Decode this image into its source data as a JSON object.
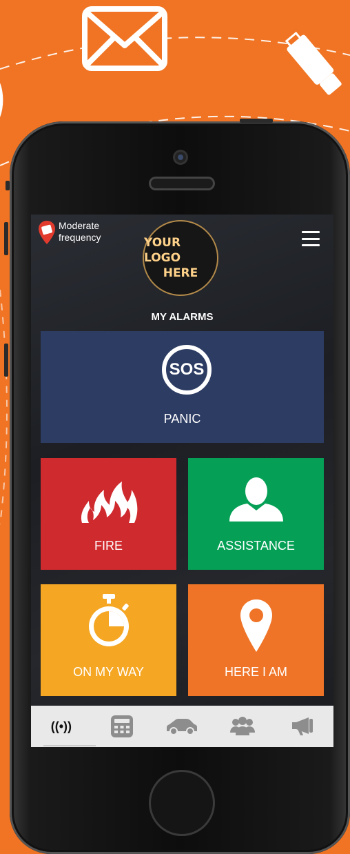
{
  "status": {
    "frequency_line1": "Moderate",
    "frequency_line2": "frequency"
  },
  "logo": {
    "line1": "YOUR LOGO",
    "line2": "HERE"
  },
  "page_title": "MY ALARMS",
  "tiles": {
    "panic": {
      "icon_text": "SOS",
      "label": "PANIC",
      "color": "#2d3c63"
    },
    "fire": {
      "label": "FIRE",
      "color": "#cf2a2e"
    },
    "assistance": {
      "label": "ASSISTANCE",
      "color": "#05a056"
    },
    "on_my_way": {
      "label": "ON MY WAY",
      "color": "#f5a623"
    },
    "here_i_am": {
      "label": "HERE I AM",
      "color": "#ef7427"
    }
  },
  "tabbar": {
    "alarms_glyph": "((•))",
    "items": [
      "alarms-icon",
      "calculator-icon",
      "car-icon",
      "group-icon",
      "megaphone-icon"
    ]
  },
  "colors": {
    "background": "#f07423",
    "accent": "#ef7427"
  }
}
